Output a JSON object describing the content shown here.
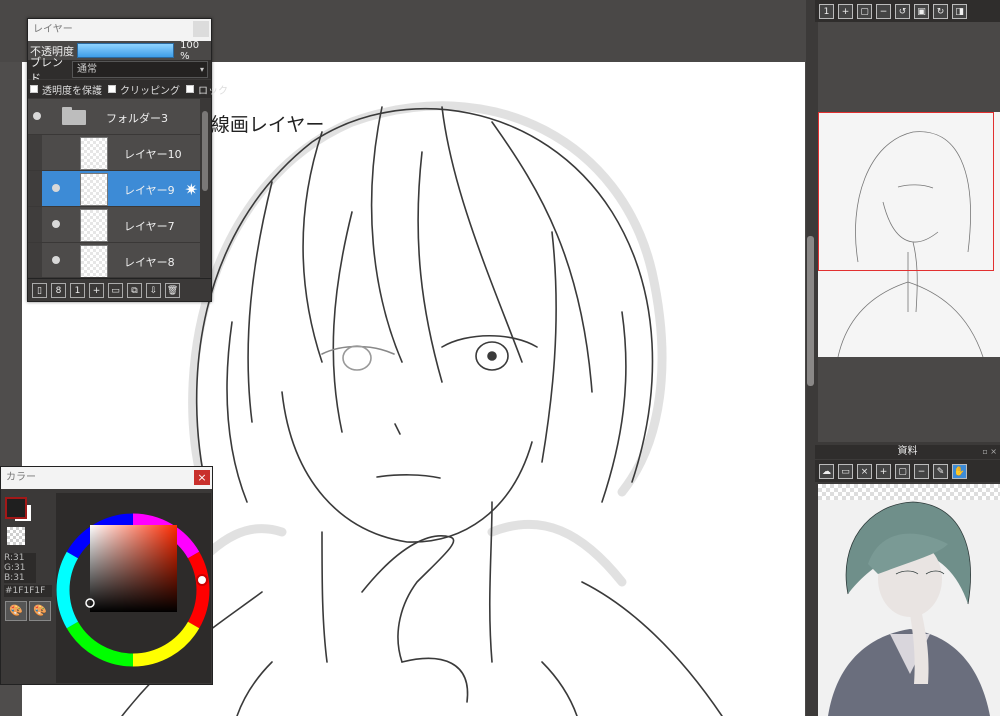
{
  "annotation": "←線画レイヤー",
  "layer_panel": {
    "title": "レイヤー",
    "opacity_label": "不透明度",
    "opacity_value": "100 %",
    "opacity_fraction": 1.0,
    "blend_label": "ブレンド",
    "blend_value": "通常",
    "options": [
      "透明度を保護",
      "クリッピング",
      "ロック"
    ],
    "layers": [
      {
        "name": "フォルダー3",
        "type": "folder",
        "visible": true,
        "selected": false
      },
      {
        "name": "レイヤー10",
        "type": "layer",
        "visible": false,
        "selected": false
      },
      {
        "name": "レイヤー9",
        "type": "layer",
        "visible": true,
        "selected": true
      },
      {
        "name": "レイヤー7",
        "type": "layer",
        "visible": true,
        "selected": false
      },
      {
        "name": "レイヤー8",
        "type": "layer",
        "visible": true,
        "selected": false
      }
    ],
    "tool_icons": [
      "new-layer-icon",
      "new-8bit-layer-icon",
      "new-1bit-layer-icon",
      "add-special-layer-icon",
      "new-folder-icon",
      "duplicate-layer-icon",
      "merge-down-icon",
      "delete-layer-icon"
    ]
  },
  "color_panel": {
    "title": "カラー",
    "close_label": "×",
    "r": "R:31",
    "g": "G:31",
    "b": "B:31",
    "hex": "#1F1F1F",
    "foreground_color": "#1f1f1f",
    "background_color": "#ffffff"
  },
  "resource_panel": {
    "title": "資料",
    "header_icons": "▫ ×"
  },
  "colors": {
    "accent": "#3d8bd6",
    "navigator_frame": "#e23030",
    "close_red": "#c9302c"
  }
}
